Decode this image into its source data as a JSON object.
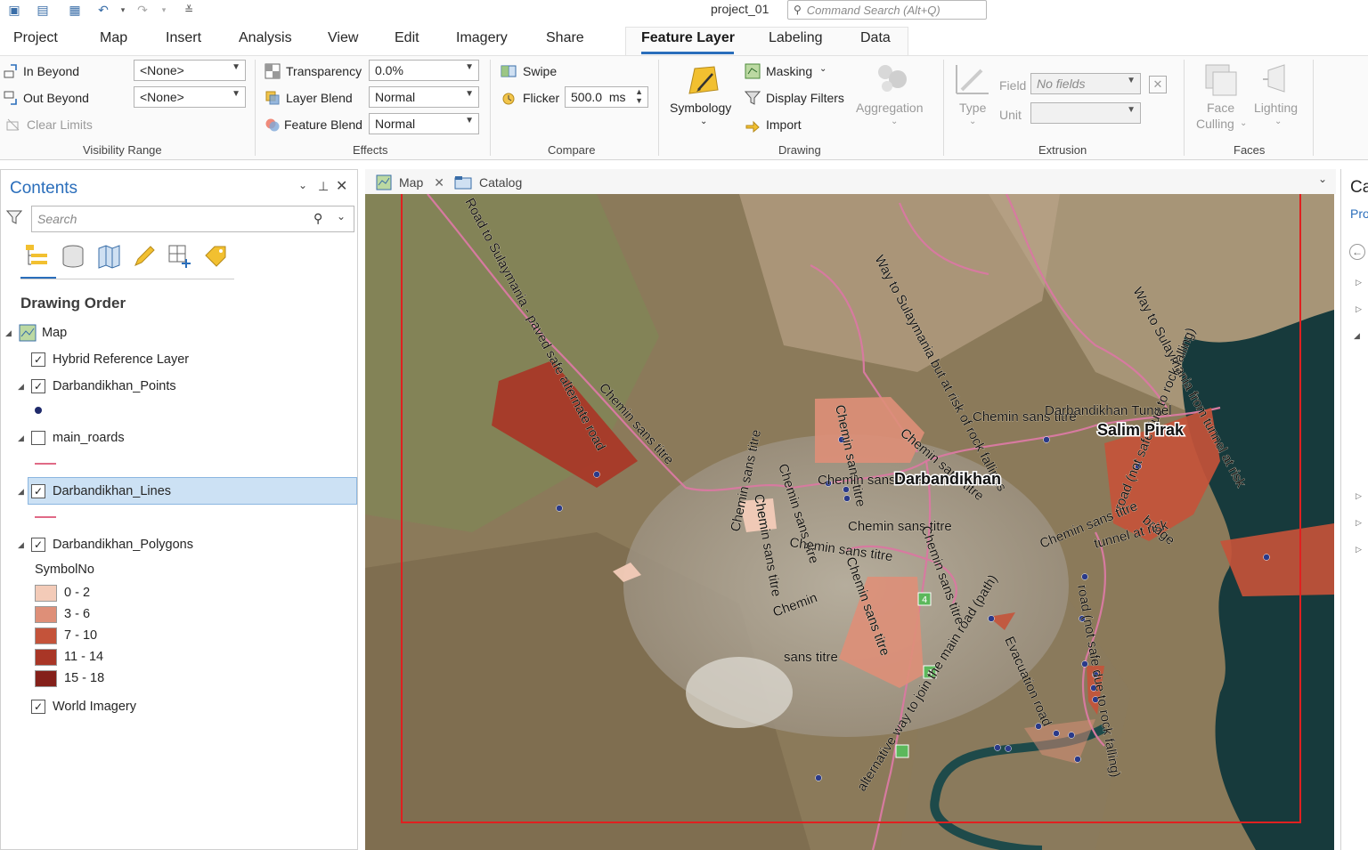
{
  "window": {
    "project_title": "project_01",
    "command_search_placeholder": "Command Search (Alt+Q)"
  },
  "ribbon_tabs": [
    "Project",
    "Map",
    "Insert",
    "Analysis",
    "View",
    "Edit",
    "Imagery",
    "Share",
    "Feature Layer",
    "Labeling",
    "Data"
  ],
  "active_tab": "Feature Layer",
  "ribbon": {
    "visibility": {
      "in_beyond": "In Beyond",
      "out_beyond": "Out Beyond",
      "clear_limits": "Clear Limits",
      "in_value": "<None>",
      "out_value": "<None>",
      "group": "Visibility Range"
    },
    "effects": {
      "transparency": "Transparency",
      "transparency_value": "0.0%",
      "layer_blend": "Layer Blend",
      "layer_blend_value": "Normal",
      "feature_blend": "Feature Blend",
      "feature_blend_value": "Normal",
      "group": "Effects"
    },
    "compare": {
      "swipe": "Swipe",
      "flicker": "Flicker",
      "flicker_value": "500.0",
      "flicker_unit": "ms",
      "group": "Compare"
    },
    "drawing": {
      "symbology": "Symbology",
      "masking": "Masking",
      "display_filters": "Display Filters",
      "import": "Import",
      "aggregation": "Aggregation",
      "group": "Drawing"
    },
    "extrusion": {
      "type": "Type",
      "field": "Field",
      "field_value": "No fields",
      "unit": "Unit",
      "group": "Extrusion"
    },
    "faces": {
      "face_culling_1": "Face",
      "face_culling_2": "Culling",
      "lighting": "Lighting",
      "group": "Faces"
    }
  },
  "contents": {
    "title": "Contents",
    "search_placeholder": "Search",
    "heading": "Drawing Order",
    "map_name": "Map",
    "layers": {
      "hybrid": "Hybrid Reference Layer",
      "points": "Darbandikhan_Points",
      "roads": "main_roards",
      "lines": "Darbandikhan_Lines",
      "polygons": "Darbandikhan_Polygons",
      "imagery": "World Imagery"
    },
    "legend_field": "SymbolNo",
    "legend": [
      {
        "label": "0 - 2",
        "color": "#f3cbb8"
      },
      {
        "label": "3 - 6",
        "color": "#de8f78"
      },
      {
        "label": "7 - 10",
        "color": "#c4533a"
      },
      {
        "label": "11 - 14",
        "color": "#a93626"
      },
      {
        "label": "15 - 18",
        "color": "#84201a"
      }
    ]
  },
  "view_tabs": {
    "map": "Map",
    "catalog": "Catalog"
  },
  "right_pane": {
    "title": "Ca",
    "sub": "Pro"
  },
  "map_labels": {
    "road_to_suly": "Road to Sulaymania - paved safe alternate road",
    "way_suly_rock": "Way to Sulaymania but at risk of rock fallings",
    "way_suly_tunnel": "Way to Sulaymania from tunnel at risk",
    "chemin_1": "Chemin sans titre",
    "chemin_2": "Chemin sans titre",
    "chemin_3": "Chemin sans titre",
    "chemin_4": "Chemin sans titre",
    "chemin_5": "Chemin sans titre",
    "chemin_6": "Chemin sans titre",
    "chemin_7": "Chemin sans titre",
    "chemin_8": "Chemin sans titre",
    "chemin_9": "Chemin sans titre",
    "chemin_10": "Chemin sans titre",
    "chemin_11": "Chemin",
    "chemin_12": "sans titre",
    "darbandikhan_town": "Darbandikhan",
    "darbandikhan_tunnel": "Darbandikhan Tunnel",
    "salim_pirak": "Salim Pirak",
    "road_not_safe": "road (not safe due to rock falling)",
    "bridge": "bridge",
    "chemin_tunnel": "Chemin sans titre",
    "tunnel_risk": "tunnel at risk",
    "road_not_safe_2": "road (not safe due to rock falling)",
    "evacuation": "Evacuation road",
    "alt_way": "alternative way to join the main road (path)",
    "bottom_chemin": "Chemin sans titre",
    "highway_shield": "4"
  }
}
